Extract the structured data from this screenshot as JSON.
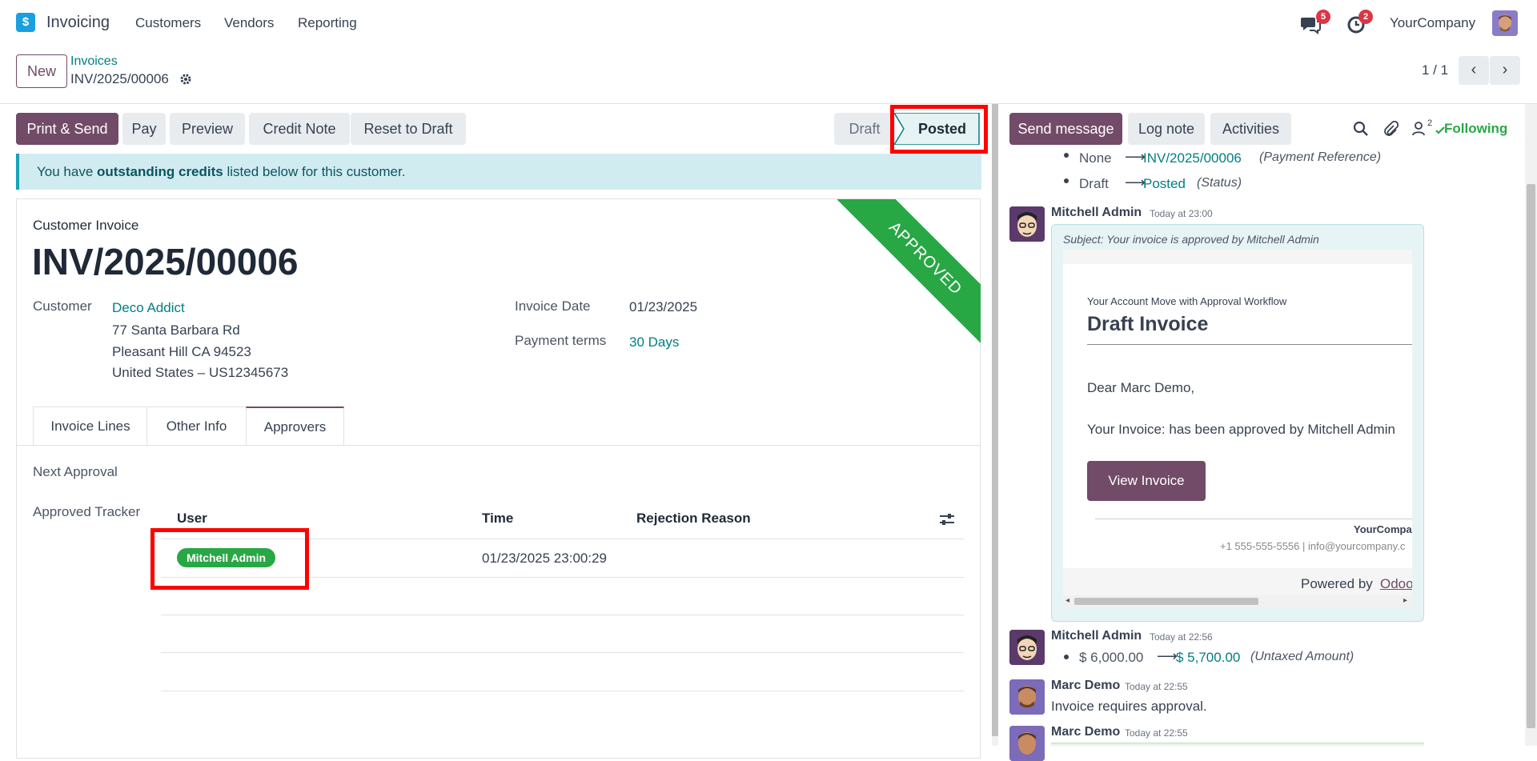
{
  "nav": {
    "app_name": "Invoicing",
    "menu": [
      "Customers",
      "Vendors",
      "Reporting"
    ],
    "messages_count": "5",
    "activities_count": "2",
    "company": "YourCompany"
  },
  "control": {
    "new_label": "New",
    "breadcrumb_parent": "Invoices",
    "record_name": "INV/2025/00006",
    "pager": "1 / 1"
  },
  "actions": {
    "print_send": "Print & Send",
    "pay": "Pay",
    "preview": "Preview",
    "credit_note": "Credit Note",
    "reset_draft": "Reset to Draft"
  },
  "statusbar": {
    "draft": "Draft",
    "posted": "Posted"
  },
  "alert": {
    "pre": "You have ",
    "bold": "outstanding credits",
    "post": " listed below for this customer."
  },
  "invoice": {
    "type_label": "Customer Invoice",
    "number": "INV/2025/00006",
    "ribbon": "APPROVED",
    "customer_label": "Customer",
    "customer_name": "Deco Addict",
    "address_line1": "77 Santa Barbara Rd",
    "address_line2": "Pleasant Hill CA 94523",
    "address_line3": "United States – US12345673",
    "date_label": "Invoice Date",
    "date_value": "01/23/2025",
    "terms_label": "Payment terms",
    "terms_value": "30 Days"
  },
  "tabs": [
    "Invoice Lines",
    "Other Info",
    "Approvers"
  ],
  "approvers": {
    "next_approval_label": "Next Approval",
    "tracker_label": "Approved Tracker",
    "columns": [
      "User",
      "Time",
      "Rejection Reason"
    ],
    "rows": [
      {
        "user": "Mitchell Admin",
        "time": "01/23/2025 23:00:29",
        "reason": ""
      }
    ]
  },
  "chatter": {
    "send_message": "Send message",
    "log_note": "Log note",
    "activities": "Activities",
    "followers_count": "2",
    "following": "Following",
    "tracking1": {
      "old": "None",
      "new": "INV/2025/00006",
      "field": "(Payment Reference)"
    },
    "tracking2": {
      "old": "Draft",
      "new": "Posted",
      "field": "(Status)"
    },
    "msg1": {
      "author": "Mitchell Admin",
      "time": "Today at 23:00",
      "subject": "Subject: Your invoice is approved by Mitchell Admin",
      "email_header_small": "Your Account Move with Approval Workflow",
      "email_title": "Draft Invoice",
      "greeting": "Dear Marc Demo,",
      "body": "Your Invoice: has been approved by Mitchell Admin",
      "button": "View Invoice",
      "footer_company": "YourCompa",
      "footer_contact": "+1 555-555-5556 | info@yourcompany.c",
      "powered_pre": "Powered by ",
      "powered_link": "Odoo"
    },
    "msg2": {
      "author": "Mitchell Admin",
      "time": "Today at 22:56",
      "old": "$ 6,000.00",
      "new": "$ 5,700.00",
      "field": "(Untaxed Amount)"
    },
    "msg3": {
      "author": "Marc Demo",
      "time": "Today at 22:55",
      "body": "Invoice requires approval."
    },
    "msg4": {
      "author": "Marc Demo",
      "time": "Today at 22:55"
    }
  },
  "colors": {
    "brand": "#714b67",
    "link": "#017e84",
    "success": "#28a745",
    "highlight": "#ff0000"
  }
}
